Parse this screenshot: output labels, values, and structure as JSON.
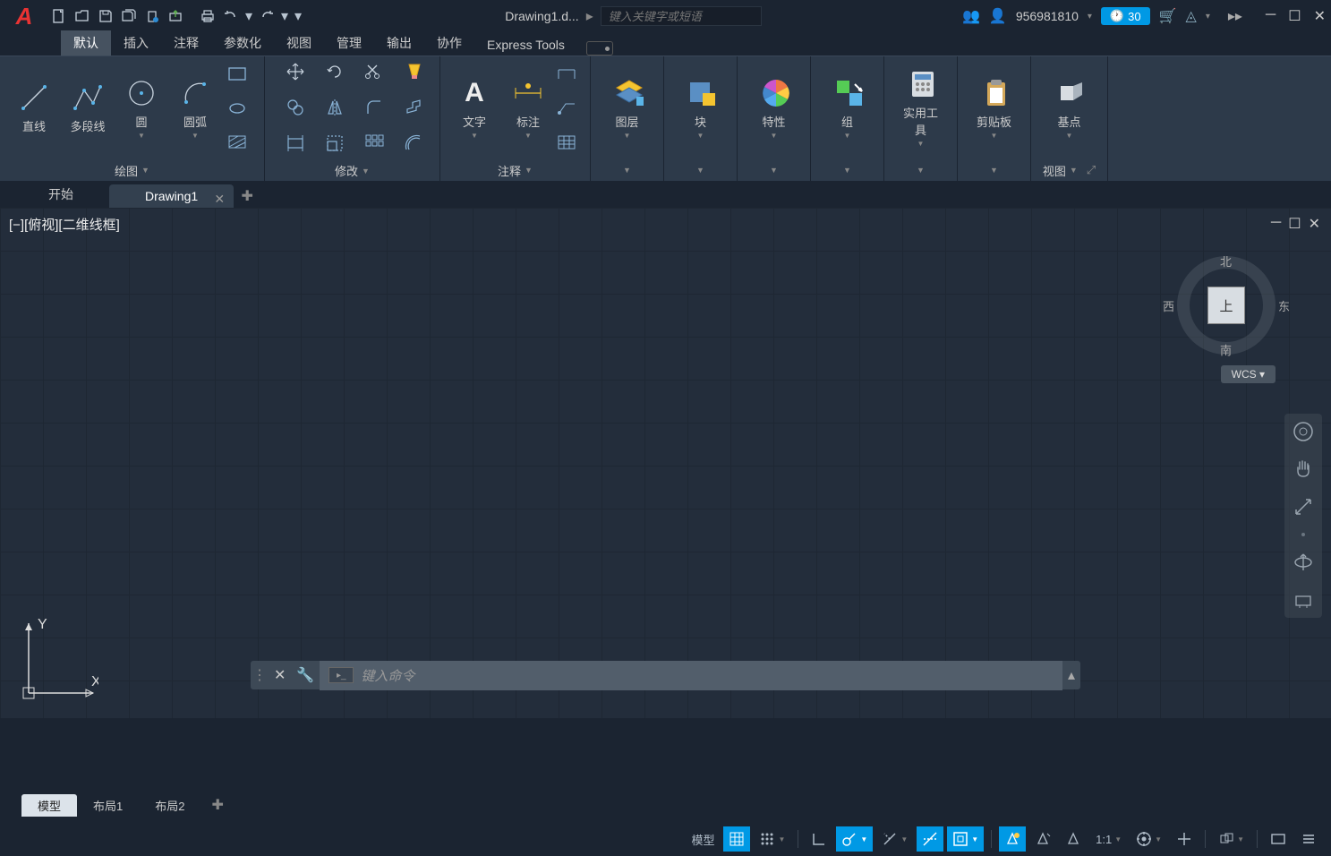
{
  "title": {
    "doc": "Drawing1.d...",
    "search_ph": "键入关键字或短语",
    "user": "956981810",
    "trial": "30"
  },
  "ribbon_tabs": [
    "默认",
    "插入",
    "注释",
    "参数化",
    "视图",
    "管理",
    "输出",
    "协作",
    "Express Tools"
  ],
  "panels": {
    "draw": {
      "title": "绘图",
      "line": "直线",
      "pline": "多段线",
      "circle": "圆",
      "arc": "圆弧"
    },
    "modify": {
      "title": "修改"
    },
    "annot": {
      "title": "注释",
      "text": "文字",
      "dim": "标注"
    },
    "layer": {
      "title": "图层"
    },
    "block": {
      "title": "块"
    },
    "prop": {
      "title": "特性"
    },
    "group": {
      "title": "组"
    },
    "util": {
      "title": "实用工具"
    },
    "clip": {
      "title": "剪贴板"
    },
    "base": {
      "title": "基点",
      "view": "视图"
    }
  },
  "file_tabs": {
    "start": "开始",
    "d1": "Drawing1"
  },
  "viewport_label": "[−][俯视][二维线框]",
  "viewcube": {
    "top": "上",
    "n": "北",
    "s": "南",
    "e": "东",
    "w": "西",
    "wcs": "WCS"
  },
  "cmd": {
    "placeholder": "键入命令"
  },
  "layout_tabs": {
    "model": "模型",
    "l1": "布局1",
    "l2": "布局2"
  },
  "status": {
    "model": "模型",
    "scale": "1:1"
  },
  "ucs": {
    "x": "X",
    "y": "Y"
  }
}
